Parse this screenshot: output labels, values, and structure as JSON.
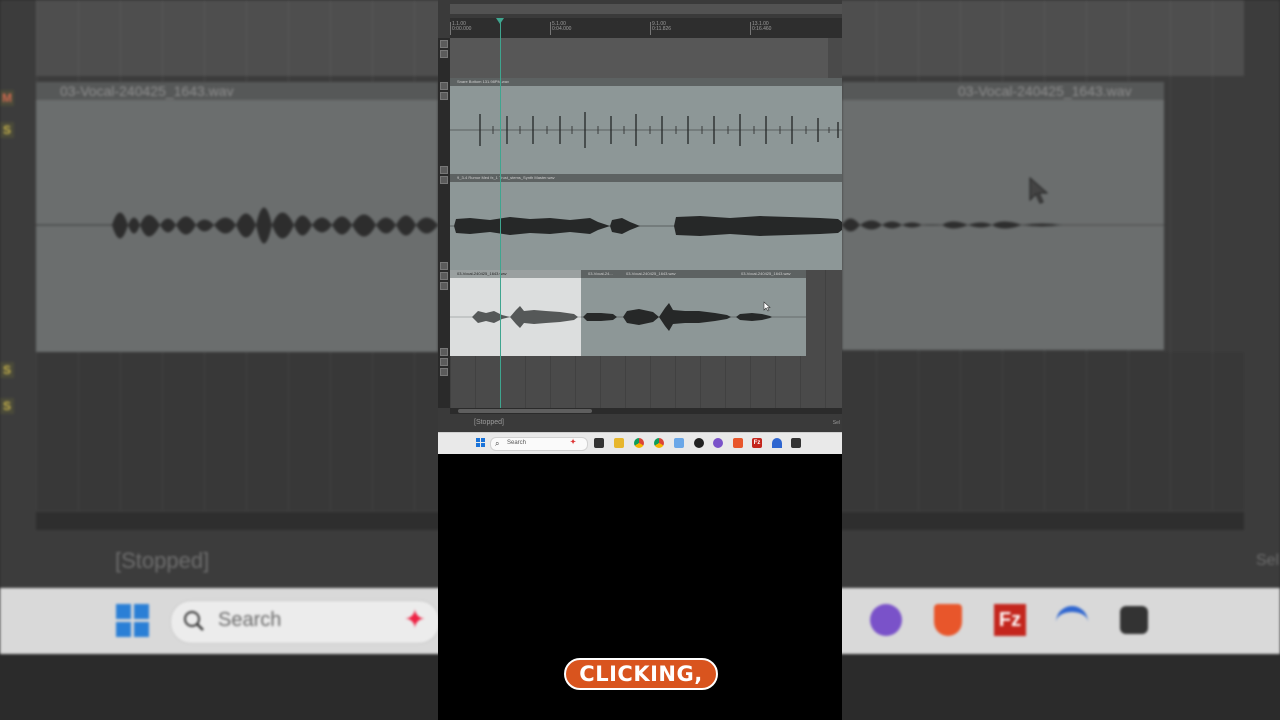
{
  "background": {
    "item_title_left": "03-Vocal-240425_1643.wav",
    "item_title_right": "03-Vocal-240425_1643.wav",
    "status": "[Stopped]",
    "sel_label": "Sel",
    "search_label": "Search",
    "side_buttons": [
      "M",
      "S",
      "S",
      "S"
    ]
  },
  "reaper": {
    "ruler_marks": [
      {
        "bar": "1.1.00",
        "time": "0:00.000"
      },
      {
        "bar": "5.1.00",
        "time": "0:04.000"
      },
      {
        "bar": "9.1.00",
        "time": "0:11.826"
      },
      {
        "bar": "13.1.00",
        "time": "0:16.460"
      }
    ],
    "tracks": [
      {
        "items": [
          {
            "title": "Snare Bottom 131.98PM.wav",
            "selected": false
          }
        ]
      },
      {
        "items": [
          {
            "title": "9_3-4 Rumor Med fx_1 Trust_stems_Synth Master.wav",
            "selected": false
          }
        ]
      },
      {
        "items": [
          {
            "title": "03-Vocal-240425_1643.wav",
            "selected": true
          },
          {
            "title": "03-Vocal-24...",
            "selected": false
          },
          {
            "title": "03-Vocal-240425_1643.wav",
            "selected": false
          },
          {
            "title": "03-Vocal-240425_1643.wav",
            "selected": false
          }
        ]
      }
    ],
    "status": "[Stopped]",
    "sel_label": "Sel"
  },
  "taskbar": {
    "search_label": "Search",
    "icons": [
      "widgets-icon",
      "file-explorer-icon",
      "folder-icon",
      "chrome-icon",
      "chrome-alt-icon",
      "snipping-icon",
      "davinci-icon",
      "tor-icon",
      "brave-icon",
      "filezilla-icon",
      "nordvpn-icon",
      "resolve-icon"
    ]
  },
  "caption": "CLICKING,",
  "colors": {
    "accent_caption": "#d9541e",
    "playhead": "#3fa58f",
    "item_bg": "#8d9797",
    "item_selected_bg": "#dcdede"
  }
}
